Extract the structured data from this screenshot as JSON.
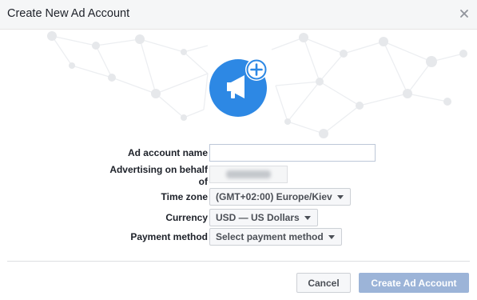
{
  "dialog": {
    "title": "Create New Ad Account",
    "close_icon": "close-icon"
  },
  "hero": {
    "icon": "megaphone-icon",
    "badge_icon": "plus-icon",
    "primary_color": "#2d88e4",
    "badge_color": "#ffffff"
  },
  "form": {
    "ad_account_name": {
      "label": "Ad account name",
      "value": ""
    },
    "advertising_on_behalf": {
      "label_line1": "Advertising on behalf",
      "label_line2": "of"
    },
    "time_zone": {
      "label": "Time zone",
      "selected": "(GMT+02:00) Europe/Kiev"
    },
    "currency": {
      "label": "Currency",
      "selected": "USD — US Dollars"
    },
    "payment_method": {
      "label": "Payment method",
      "selected": "Select payment method"
    }
  },
  "footer": {
    "cancel_label": "Cancel",
    "create_label": "Create Ad Account",
    "create_disabled_color": "#9cb4d8"
  }
}
